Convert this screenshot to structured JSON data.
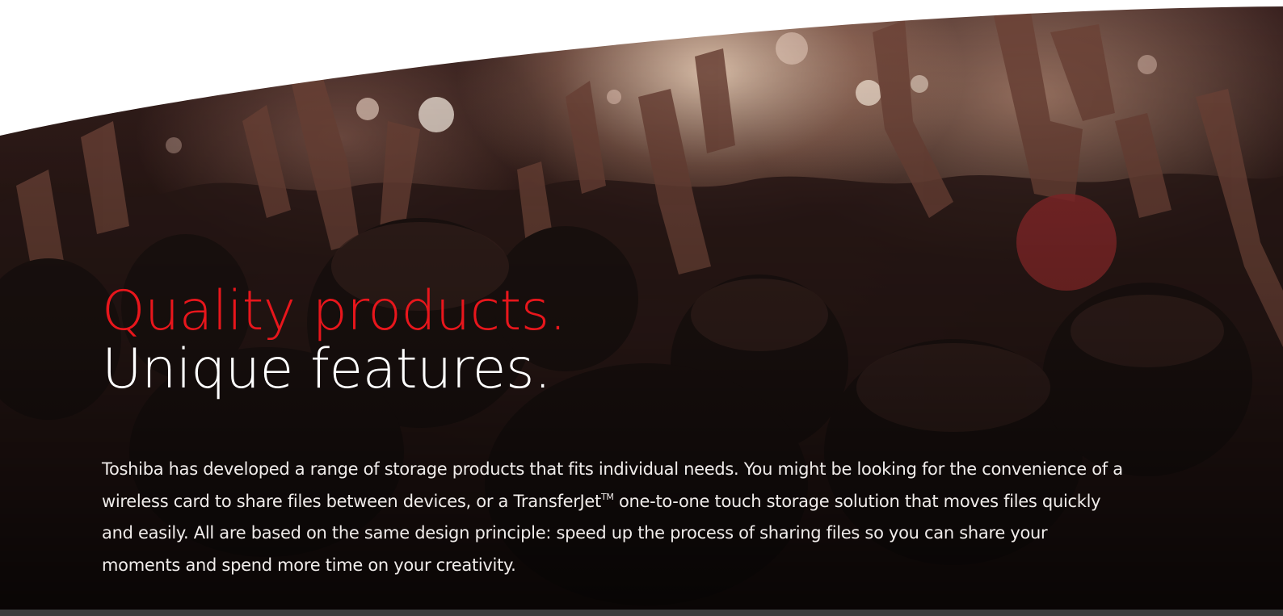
{
  "hero": {
    "headline_line1": "Quality products.",
    "headline_line2": "Unique features.",
    "body_part1": "Toshiba has developed a range of storage products that fits individual needs. You might be looking for the convenience of a wireless card to share files between devices, or a TransferJet",
    "body_tm": "TM",
    "body_part2": " one-to-one touch storage solution that moves files quickly and easily. All are based on the same design principle: speed up the process of sharing files so you can share your moments and spend more time on your creativity."
  },
  "colors": {
    "accent_red": "#e8161c",
    "text_white": "#ffffff",
    "top_shape": "#ffffff"
  },
  "icons": {
    "background_photo": "concert-crowd-hands-raised"
  }
}
